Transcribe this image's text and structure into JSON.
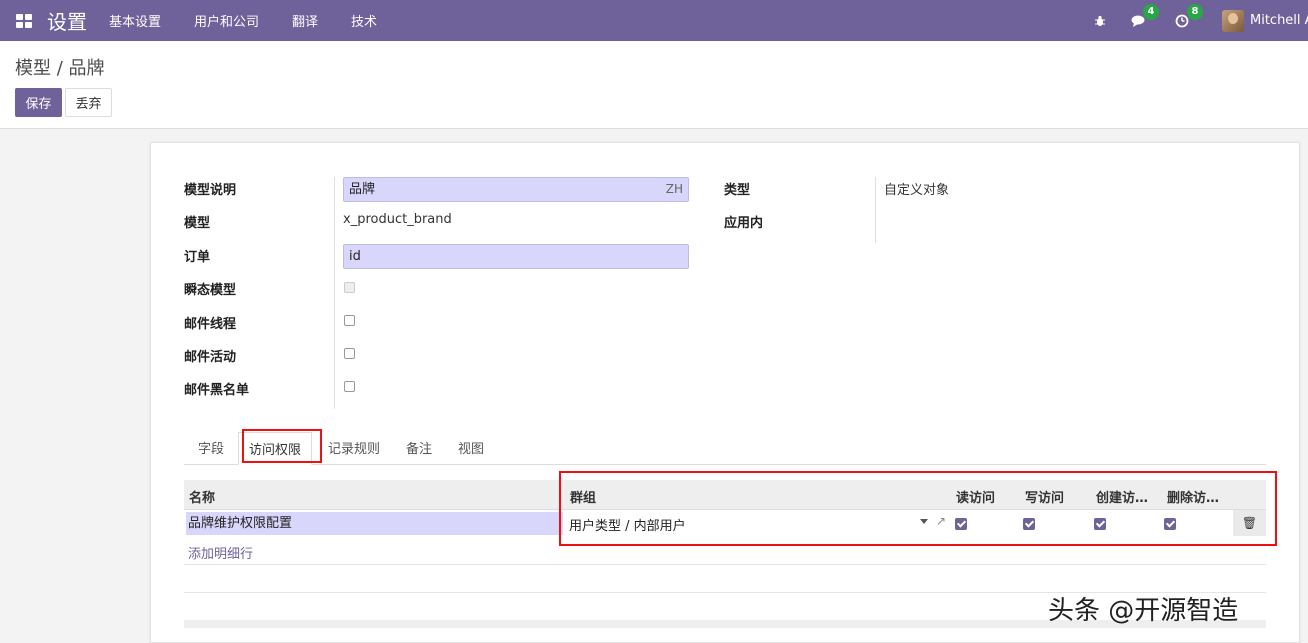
{
  "navbar": {
    "app_title": "设置",
    "menu": [
      "基本设置",
      "用户和公司",
      "翻译",
      "技术"
    ],
    "bug_icon": "bug-icon",
    "messages_count": "4",
    "activities_count": "8",
    "user_name": "Mitchell A"
  },
  "control": {
    "breadcrumb": "模型 / 品牌",
    "save_label": "保存",
    "discard_label": "丢弃"
  },
  "form": {
    "model_desc_label": "模型说明",
    "model_desc_value": "品牌",
    "model_desc_lang": "ZH",
    "model_label": "模型",
    "model_value": "x_product_brand",
    "order_label": "订单",
    "order_value": "id",
    "transient_label": "瞬态模型",
    "mail_thread_label": "邮件线程",
    "mail_activity_label": "邮件活动",
    "mail_blacklist_label": "邮件黑名单",
    "type_label": "类型",
    "type_value": "自定义对象",
    "in_apps_label": "应用内"
  },
  "tabs": [
    "字段",
    "访问权限",
    "记录规则",
    "备注",
    "视图"
  ],
  "access_table": {
    "headers": {
      "name": "名称",
      "group": "群组",
      "read": "读访问",
      "write": "写访问",
      "create": "创建访…",
      "unlink": "删除访…"
    },
    "rows": [
      {
        "name": "品牌维护权限配置",
        "group": "用户类型 / 内部用户",
        "read": true,
        "write": true,
        "create": true,
        "unlink": true
      }
    ],
    "add_line_label": "添加明细行"
  },
  "watermark": "头条 @开源智造"
}
